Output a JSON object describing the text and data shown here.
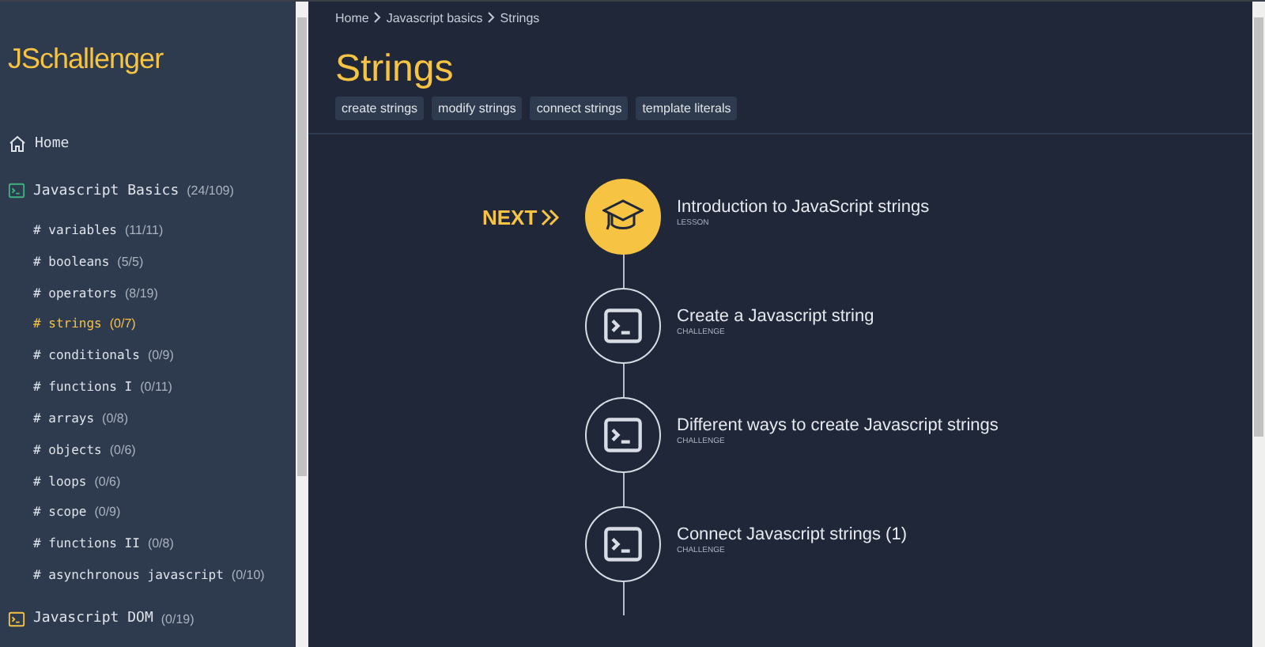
{
  "logo": "JSchallenger",
  "sidebar": {
    "home": "Home",
    "items": [
      {
        "kind": "group",
        "label": "Javascript Basics",
        "count": "(24/109)",
        "color": "#3fb37f",
        "selected": false
      },
      {
        "kind": "topic",
        "label": "# variables",
        "count": "(11/11)",
        "selected": false
      },
      {
        "kind": "topic",
        "label": "# booleans",
        "count": "(5/5)",
        "selected": false
      },
      {
        "kind": "topic",
        "label": "# operators",
        "count": "(8/19)",
        "selected": false
      },
      {
        "kind": "topic",
        "label": "# strings",
        "count": "(0/7)",
        "selected": true
      },
      {
        "kind": "topic",
        "label": "# conditionals",
        "count": "(0/9)",
        "selected": false
      },
      {
        "kind": "topic",
        "label": "# functions I",
        "count": "(0/11)",
        "selected": false
      },
      {
        "kind": "topic",
        "label": "# arrays",
        "count": "(0/8)",
        "selected": false
      },
      {
        "kind": "topic",
        "label": "# objects",
        "count": "(0/6)",
        "selected": false
      },
      {
        "kind": "topic",
        "label": "# loops",
        "count": "(0/6)",
        "selected": false
      },
      {
        "kind": "topic",
        "label": "# scope",
        "count": "(0/9)",
        "selected": false
      },
      {
        "kind": "topic",
        "label": "# functions II",
        "count": "(0/8)",
        "selected": false
      },
      {
        "kind": "topic",
        "label": "# asynchronous javascript",
        "count": "(0/10)",
        "selected": false
      },
      {
        "kind": "group",
        "label": "Javascript DOM",
        "count": "(0/19)",
        "color": "#f6c343",
        "selected": false
      }
    ]
  },
  "breadcrumb": [
    "Home",
    "Javascript basics",
    "Strings"
  ],
  "title": "Strings",
  "tags": [
    "create strings",
    "modify strings",
    "connect strings",
    "template literals"
  ],
  "next_label": "NEXT",
  "steps": [
    {
      "kind": "lesson",
      "title": "Introduction to JavaScript strings",
      "type": "LESSON",
      "next": true
    },
    {
      "kind": "challenge",
      "title": "Create a Javascript string",
      "type": "CHALLENGE",
      "next": false
    },
    {
      "kind": "challenge",
      "title": "Different ways to create Javascript strings",
      "type": "CHALLENGE",
      "next": false
    },
    {
      "kind": "challenge",
      "title": "Connect Javascript strings (1)",
      "type": "CHALLENGE",
      "next": false
    }
  ]
}
